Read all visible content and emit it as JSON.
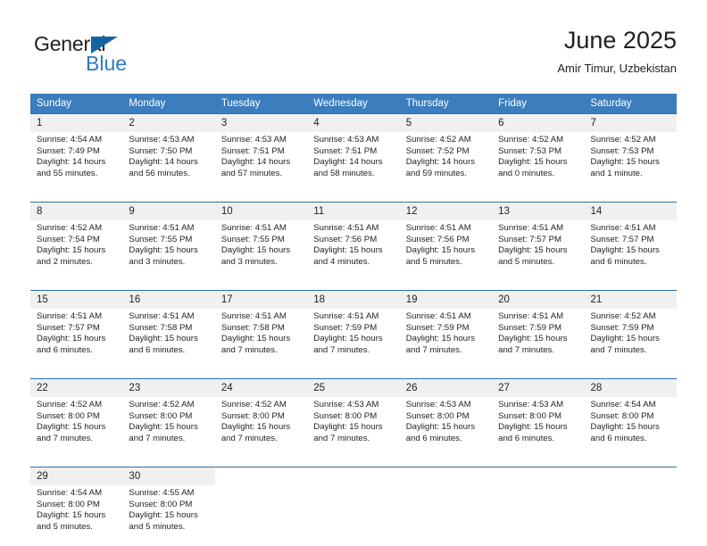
{
  "brand": {
    "name_part1": "General",
    "name_part2": "Blue",
    "accent_color": "#1464a5",
    "blue_text_color": "#2b7cc0"
  },
  "header": {
    "title": "June 2025",
    "subtitle": "Amir Timur, Uzbekistan"
  },
  "calendar": {
    "header_bg": "#3b7dbd",
    "daynum_bg": "#f0f0f0",
    "weekday_headers": [
      "Sunday",
      "Monday",
      "Tuesday",
      "Wednesday",
      "Thursday",
      "Friday",
      "Saturday"
    ],
    "weeks": [
      [
        {
          "day": "1",
          "sunrise": "Sunrise: 4:54 AM",
          "sunset": "Sunset: 7:49 PM",
          "daylight_line1": "Daylight: 14 hours",
          "daylight_line2": "and 55 minutes."
        },
        {
          "day": "2",
          "sunrise": "Sunrise: 4:53 AM",
          "sunset": "Sunset: 7:50 PM",
          "daylight_line1": "Daylight: 14 hours",
          "daylight_line2": "and 56 minutes."
        },
        {
          "day": "3",
          "sunrise": "Sunrise: 4:53 AM",
          "sunset": "Sunset: 7:51 PM",
          "daylight_line1": "Daylight: 14 hours",
          "daylight_line2": "and 57 minutes."
        },
        {
          "day": "4",
          "sunrise": "Sunrise: 4:53 AM",
          "sunset": "Sunset: 7:51 PM",
          "daylight_line1": "Daylight: 14 hours",
          "daylight_line2": "and 58 minutes."
        },
        {
          "day": "5",
          "sunrise": "Sunrise: 4:52 AM",
          "sunset": "Sunset: 7:52 PM",
          "daylight_line1": "Daylight: 14 hours",
          "daylight_line2": "and 59 minutes."
        },
        {
          "day": "6",
          "sunrise": "Sunrise: 4:52 AM",
          "sunset": "Sunset: 7:53 PM",
          "daylight_line1": "Daylight: 15 hours",
          "daylight_line2": "and 0 minutes."
        },
        {
          "day": "7",
          "sunrise": "Sunrise: 4:52 AM",
          "sunset": "Sunset: 7:53 PM",
          "daylight_line1": "Daylight: 15 hours",
          "daylight_line2": "and 1 minute."
        }
      ],
      [
        {
          "day": "8",
          "sunrise": "Sunrise: 4:52 AM",
          "sunset": "Sunset: 7:54 PM",
          "daylight_line1": "Daylight: 15 hours",
          "daylight_line2": "and 2 minutes."
        },
        {
          "day": "9",
          "sunrise": "Sunrise: 4:51 AM",
          "sunset": "Sunset: 7:55 PM",
          "daylight_line1": "Daylight: 15 hours",
          "daylight_line2": "and 3 minutes."
        },
        {
          "day": "10",
          "sunrise": "Sunrise: 4:51 AM",
          "sunset": "Sunset: 7:55 PM",
          "daylight_line1": "Daylight: 15 hours",
          "daylight_line2": "and 3 minutes."
        },
        {
          "day": "11",
          "sunrise": "Sunrise: 4:51 AM",
          "sunset": "Sunset: 7:56 PM",
          "daylight_line1": "Daylight: 15 hours",
          "daylight_line2": "and 4 minutes."
        },
        {
          "day": "12",
          "sunrise": "Sunrise: 4:51 AM",
          "sunset": "Sunset: 7:56 PM",
          "daylight_line1": "Daylight: 15 hours",
          "daylight_line2": "and 5 minutes."
        },
        {
          "day": "13",
          "sunrise": "Sunrise: 4:51 AM",
          "sunset": "Sunset: 7:57 PM",
          "daylight_line1": "Daylight: 15 hours",
          "daylight_line2": "and 5 minutes."
        },
        {
          "day": "14",
          "sunrise": "Sunrise: 4:51 AM",
          "sunset": "Sunset: 7:57 PM",
          "daylight_line1": "Daylight: 15 hours",
          "daylight_line2": "and 6 minutes."
        }
      ],
      [
        {
          "day": "15",
          "sunrise": "Sunrise: 4:51 AM",
          "sunset": "Sunset: 7:57 PM",
          "daylight_line1": "Daylight: 15 hours",
          "daylight_line2": "and 6 minutes."
        },
        {
          "day": "16",
          "sunrise": "Sunrise: 4:51 AM",
          "sunset": "Sunset: 7:58 PM",
          "daylight_line1": "Daylight: 15 hours",
          "daylight_line2": "and 6 minutes."
        },
        {
          "day": "17",
          "sunrise": "Sunrise: 4:51 AM",
          "sunset": "Sunset: 7:58 PM",
          "daylight_line1": "Daylight: 15 hours",
          "daylight_line2": "and 7 minutes."
        },
        {
          "day": "18",
          "sunrise": "Sunrise: 4:51 AM",
          "sunset": "Sunset: 7:59 PM",
          "daylight_line1": "Daylight: 15 hours",
          "daylight_line2": "and 7 minutes."
        },
        {
          "day": "19",
          "sunrise": "Sunrise: 4:51 AM",
          "sunset": "Sunset: 7:59 PM",
          "daylight_line1": "Daylight: 15 hours",
          "daylight_line2": "and 7 minutes."
        },
        {
          "day": "20",
          "sunrise": "Sunrise: 4:51 AM",
          "sunset": "Sunset: 7:59 PM",
          "daylight_line1": "Daylight: 15 hours",
          "daylight_line2": "and 7 minutes."
        },
        {
          "day": "21",
          "sunrise": "Sunrise: 4:52 AM",
          "sunset": "Sunset: 7:59 PM",
          "daylight_line1": "Daylight: 15 hours",
          "daylight_line2": "and 7 minutes."
        }
      ],
      [
        {
          "day": "22",
          "sunrise": "Sunrise: 4:52 AM",
          "sunset": "Sunset: 8:00 PM",
          "daylight_line1": "Daylight: 15 hours",
          "daylight_line2": "and 7 minutes."
        },
        {
          "day": "23",
          "sunrise": "Sunrise: 4:52 AM",
          "sunset": "Sunset: 8:00 PM",
          "daylight_line1": "Daylight: 15 hours",
          "daylight_line2": "and 7 minutes."
        },
        {
          "day": "24",
          "sunrise": "Sunrise: 4:52 AM",
          "sunset": "Sunset: 8:00 PM",
          "daylight_line1": "Daylight: 15 hours",
          "daylight_line2": "and 7 minutes."
        },
        {
          "day": "25",
          "sunrise": "Sunrise: 4:53 AM",
          "sunset": "Sunset: 8:00 PM",
          "daylight_line1": "Daylight: 15 hours",
          "daylight_line2": "and 7 minutes."
        },
        {
          "day": "26",
          "sunrise": "Sunrise: 4:53 AM",
          "sunset": "Sunset: 8:00 PM",
          "daylight_line1": "Daylight: 15 hours",
          "daylight_line2": "and 6 minutes."
        },
        {
          "day": "27",
          "sunrise": "Sunrise: 4:53 AM",
          "sunset": "Sunset: 8:00 PM",
          "daylight_line1": "Daylight: 15 hours",
          "daylight_line2": "and 6 minutes."
        },
        {
          "day": "28",
          "sunrise": "Sunrise: 4:54 AM",
          "sunset": "Sunset: 8:00 PM",
          "daylight_line1": "Daylight: 15 hours",
          "daylight_line2": "and 6 minutes."
        }
      ],
      [
        {
          "day": "29",
          "sunrise": "Sunrise: 4:54 AM",
          "sunset": "Sunset: 8:00 PM",
          "daylight_line1": "Daylight: 15 hours",
          "daylight_line2": "and 5 minutes."
        },
        {
          "day": "30",
          "sunrise": "Sunrise: 4:55 AM",
          "sunset": "Sunset: 8:00 PM",
          "daylight_line1": "Daylight: 15 hours",
          "daylight_line2": "and 5 minutes."
        },
        {
          "day": "",
          "sunrise": "",
          "sunset": "",
          "daylight_line1": "",
          "daylight_line2": ""
        },
        {
          "day": "",
          "sunrise": "",
          "sunset": "",
          "daylight_line1": "",
          "daylight_line2": ""
        },
        {
          "day": "",
          "sunrise": "",
          "sunset": "",
          "daylight_line1": "",
          "daylight_line2": ""
        },
        {
          "day": "",
          "sunrise": "",
          "sunset": "",
          "daylight_line1": "",
          "daylight_line2": ""
        },
        {
          "day": "",
          "sunrise": "",
          "sunset": "",
          "daylight_line1": "",
          "daylight_line2": ""
        }
      ]
    ]
  }
}
